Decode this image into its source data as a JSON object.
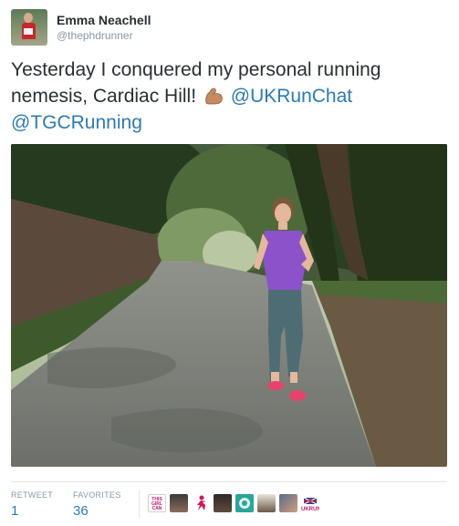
{
  "author": {
    "name": "Emma Neachell",
    "handle": "@thephdrunner"
  },
  "tweet": {
    "text_before": "Yesterday I conquered my personal running nemesis, Cardiac Hill!",
    "emoji": "flexed-biceps-emoji",
    "mention_1": "@UKRunChat",
    "mention_2": "@TGCRunning",
    "mention_color": "#2b7bb9"
  },
  "photo": {
    "subject": "woman-running-up-hill-photo"
  },
  "stats": {
    "retweet_label": "RETWEET",
    "retweet_count": "1",
    "favorites_label": "FAVORITES",
    "favorites_count": "36"
  },
  "favoriters": [
    {
      "icon": "the-girl-can-logo",
      "text": "THIS GIRL CAN"
    },
    {
      "icon": "runner-avatar-1"
    },
    {
      "icon": "pink-runner-avatar"
    },
    {
      "icon": "runner-avatar-2"
    },
    {
      "icon": "teal-badge-avatar"
    },
    {
      "icon": "runner-avatar-3"
    },
    {
      "icon": "group-selfie-avatar"
    },
    {
      "icon": "ukrunchat-logo",
      "text": "UKRUN"
    }
  ]
}
